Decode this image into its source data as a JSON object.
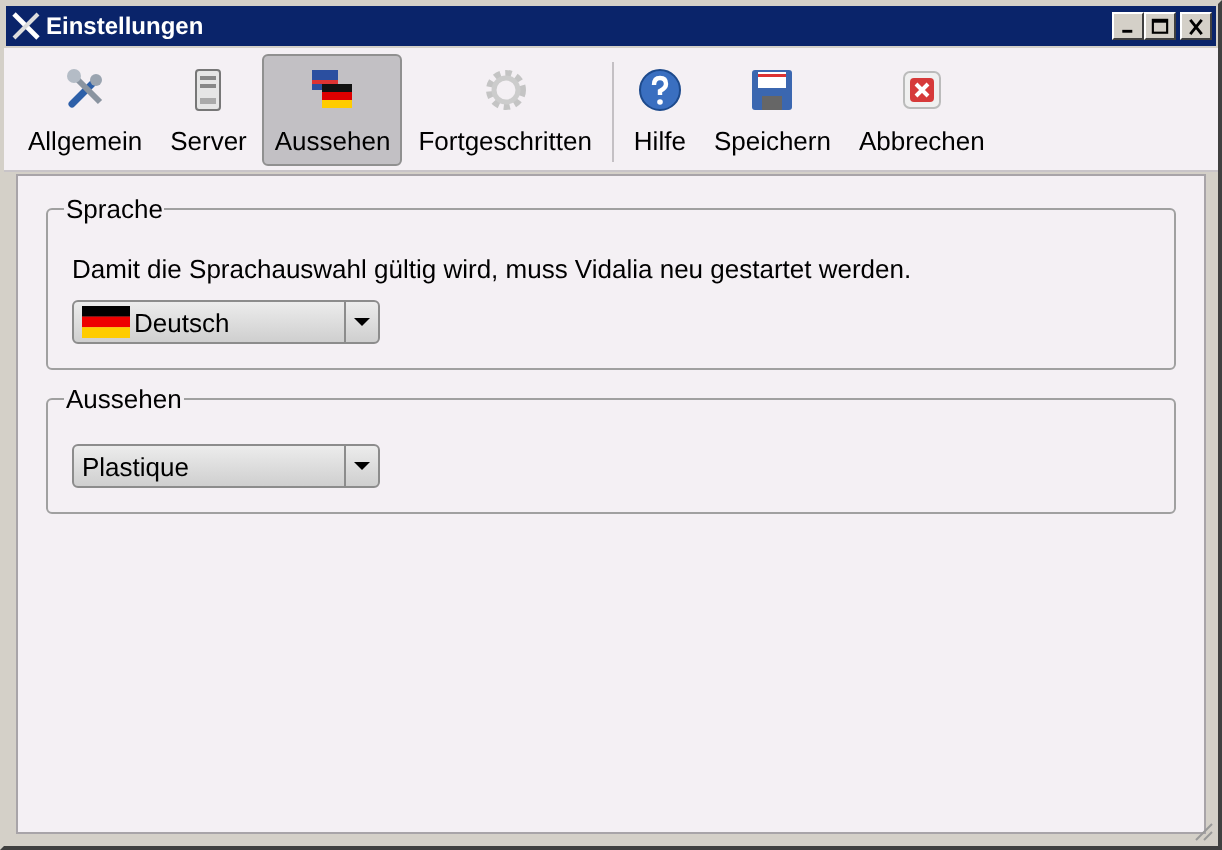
{
  "window": {
    "title": "Einstellungen"
  },
  "pages": [
    {
      "label": "Allgemein",
      "kind": "tools",
      "selected": false
    },
    {
      "label": "Server",
      "kind": "server",
      "selected": false
    },
    {
      "label": "Aussehen",
      "kind": "flags",
      "selected": true
    },
    {
      "label": "Fortgeschritten",
      "kind": "gear",
      "selected": false
    }
  ],
  "actions": [
    {
      "label": "Hilfe",
      "kind": "help"
    },
    {
      "label": "Speichern",
      "kind": "save"
    },
    {
      "label": "Abbrechen",
      "kind": "cancel"
    }
  ],
  "groups": [
    {
      "title": "Sprache",
      "note": "Damit die Sprachauswahl gültig wird, muss Vidalia neu gestartet werden.",
      "value": "Deutsch",
      "flag": true
    },
    {
      "title": "Aussehen",
      "value": "Plastique",
      "flag": false
    }
  ]
}
